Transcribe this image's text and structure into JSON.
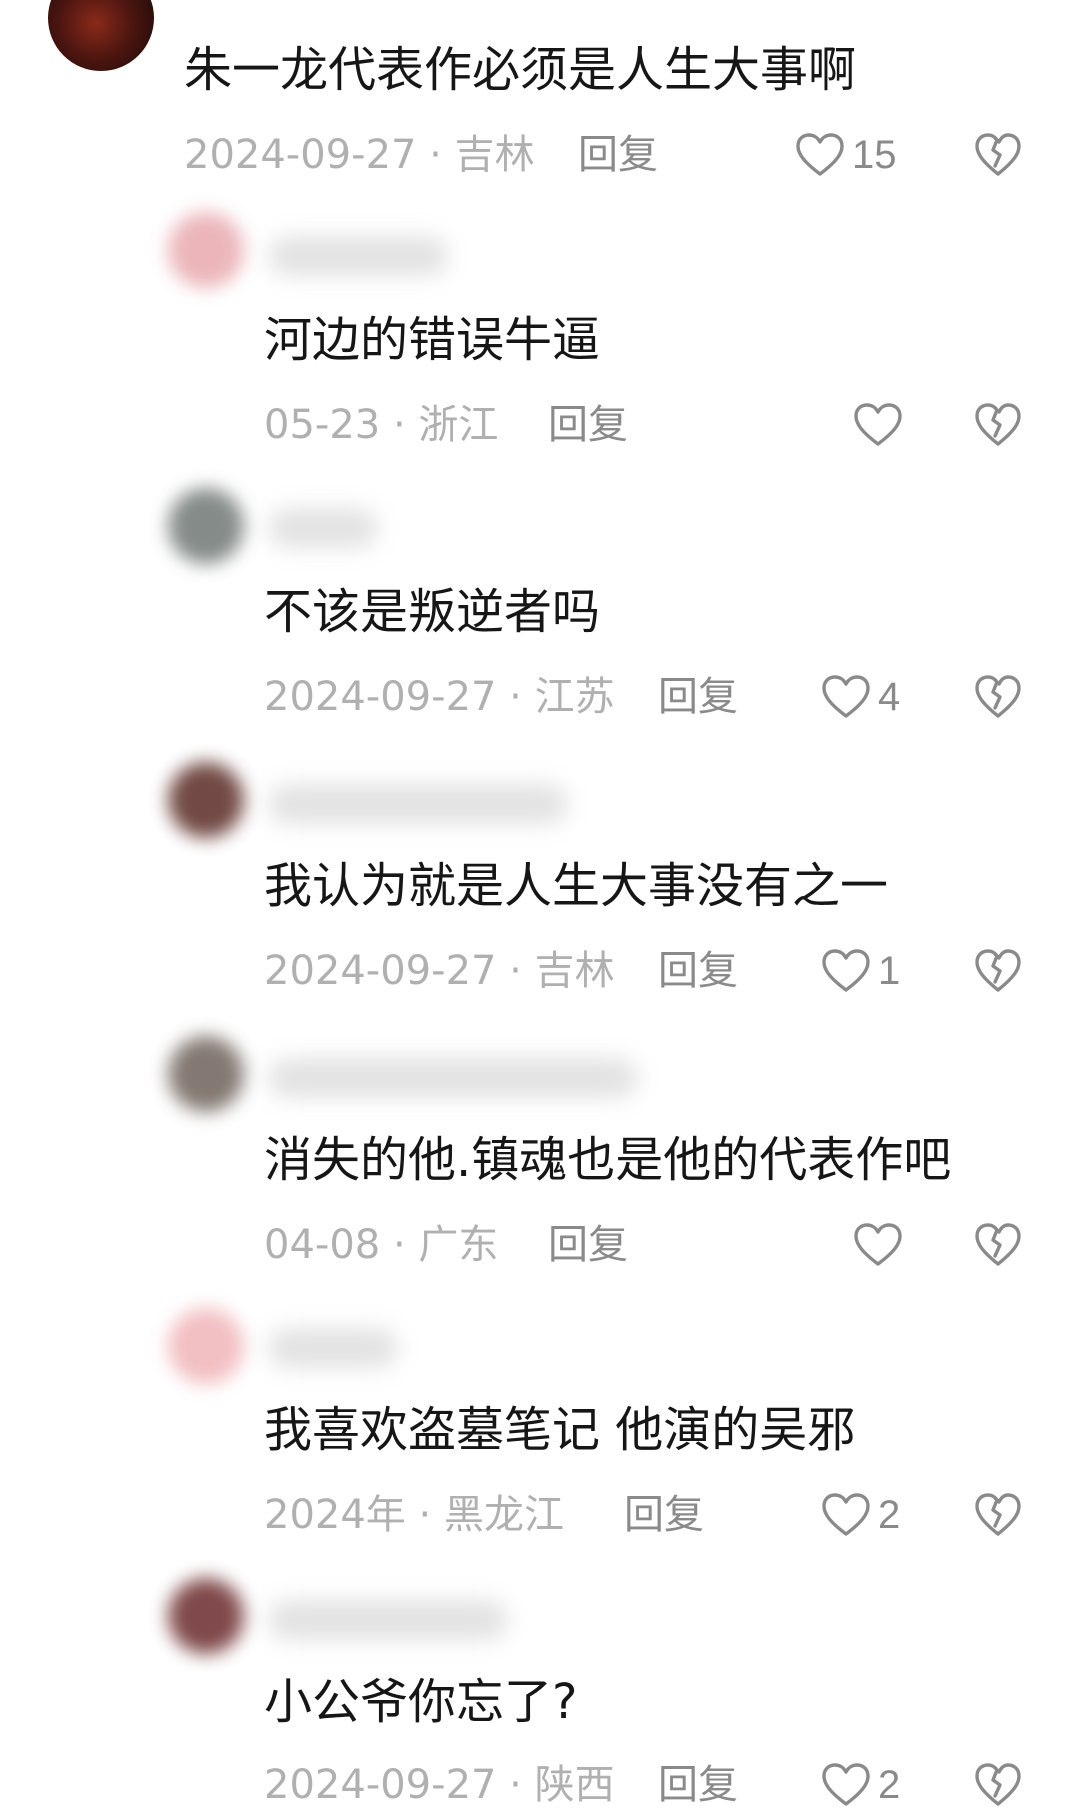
{
  "ui": {
    "reply_label": "回复",
    "like_icon": "heart-outline-icon",
    "dislike_icon": "broken-heart-icon"
  },
  "comments": [
    {
      "text": "朱一龙代表作必须是人生大事啊",
      "date": "2024-09-27",
      "location": "吉林",
      "likes": "15"
    },
    {
      "text": "河边的错误牛逼",
      "date": "05-23",
      "location": "浙江",
      "likes": ""
    },
    {
      "text": "不该是叛逆者吗",
      "date": "2024-09-27",
      "location": "江苏",
      "likes": "4"
    },
    {
      "text": "我认为就是人生大事没有之一",
      "date": "2024-09-27",
      "location": "吉林",
      "likes": "1"
    },
    {
      "text": "消失的他.镇魂也是他的代表作吧",
      "date": "04-08",
      "location": "广东",
      "likes": ""
    },
    {
      "text": "我喜欢盗墓笔记 他演的吴邪",
      "date": "2024年",
      "location": "黑龙江",
      "likes": "2"
    },
    {
      "text": "小公爷你忘了?",
      "date": "2024-09-27",
      "location": "陕西",
      "likes": "2"
    }
  ]
}
